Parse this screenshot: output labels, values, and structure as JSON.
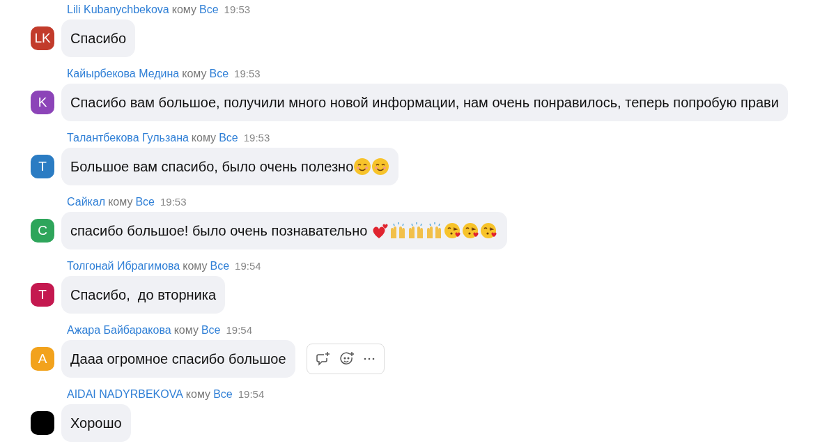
{
  "messages": [
    {
      "initials": "LK",
      "color": "#c23b2b",
      "sender": "Lili Kubanychbekova",
      "to_word": "кому",
      "recipient": "Все",
      "time": "19:53",
      "text": "Спасибо",
      "hovered": false
    },
    {
      "initials": "K",
      "color": "#8c44b8",
      "sender": "Кайырбекова Медина",
      "to_word": "кому",
      "recipient": "Все",
      "time": "19:53",
      "text": "Спасибо вам большое, получили много новой информации, нам очень понравилось, теперь попробую прави",
      "hovered": false
    },
    {
      "initials": "T",
      "color": "#2b7cc3",
      "sender": "Талантбекова Гульзана",
      "to_word": "кому",
      "recipient": "Все",
      "time": "19:53",
      "text": "Большое вам спасибо, было очень полезно",
      "emojis": [
        {
          "kind": "smile"
        },
        {
          "kind": "smile"
        }
      ],
      "hovered": false
    },
    {
      "initials": "С",
      "color": "#2ea55b",
      "sender": "Сайкал",
      "to_word": "кому",
      "recipient": "Все",
      "time": "19:53",
      "text": "спасибо большое! было очень познавательно ",
      "emojis": [
        {
          "kind": "hearts"
        },
        {
          "kind": "hands"
        },
        {
          "kind": "hands"
        },
        {
          "kind": "hands"
        },
        {
          "kind": "kiss"
        },
        {
          "kind": "kiss"
        },
        {
          "kind": "kiss"
        }
      ],
      "hovered": false
    },
    {
      "initials": "T",
      "color": "#c4184f",
      "sender": "Толгонай Ибрагимова",
      "to_word": "кому",
      "recipient": "Все",
      "time": "19:54",
      "text": "Спасибо,  до вторника",
      "hovered": false
    },
    {
      "initials": "A",
      "color": "#f2a21c",
      "sender": "Ажара Байбаракова",
      "to_word": "кому",
      "recipient": "Все",
      "time": "19:54",
      "text": "Дааа огромное спасибо большое",
      "hovered": true
    },
    {
      "color": "#000000",
      "sender": "AIDAI NADYRBEKOVA",
      "to_word": "кому",
      "recipient": "Все",
      "time": "19:54",
      "text": "Хорошо",
      "hovered": false
    }
  ]
}
